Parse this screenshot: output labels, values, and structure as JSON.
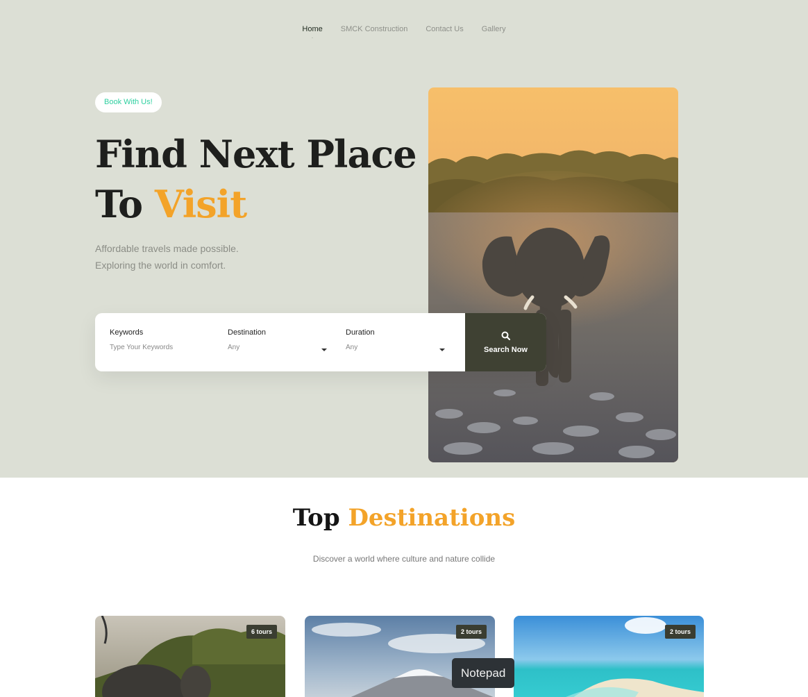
{
  "nav": {
    "items": [
      {
        "label": "Home"
      },
      {
        "label": "SMCK Construction"
      },
      {
        "label": "Contact Us"
      },
      {
        "label": "Gallery"
      }
    ]
  },
  "hero": {
    "badge": "Book With Us!",
    "headline_line1": "Find Next Place",
    "headline_to": "To ",
    "headline_accent": "Visit",
    "subtext_line1": "Affordable travels made possible.",
    "subtext_line2": "Exploring the world in comfort."
  },
  "search": {
    "keywords_label": "Keywords",
    "keywords_placeholder": "Type Your Keywords",
    "destination_label": "Destination",
    "destination_value": "Any",
    "duration_label": "Duration",
    "duration_value": "Any",
    "button_label": "Search Now"
  },
  "destinations": {
    "title_part1": "Top ",
    "title_accent": "Destinations",
    "subtitle": "Discover a world where culture and nature collide",
    "cards": [
      {
        "tours": "6 tours"
      },
      {
        "tours": "2 tours"
      },
      {
        "tours": "2 tours"
      }
    ]
  },
  "tooltip": "Notepad",
  "colors": {
    "hero_bg": "#dcdfd5",
    "accent": "#f3a329",
    "badge_text": "#2fd0a0",
    "button_bg": "#3f4133"
  }
}
